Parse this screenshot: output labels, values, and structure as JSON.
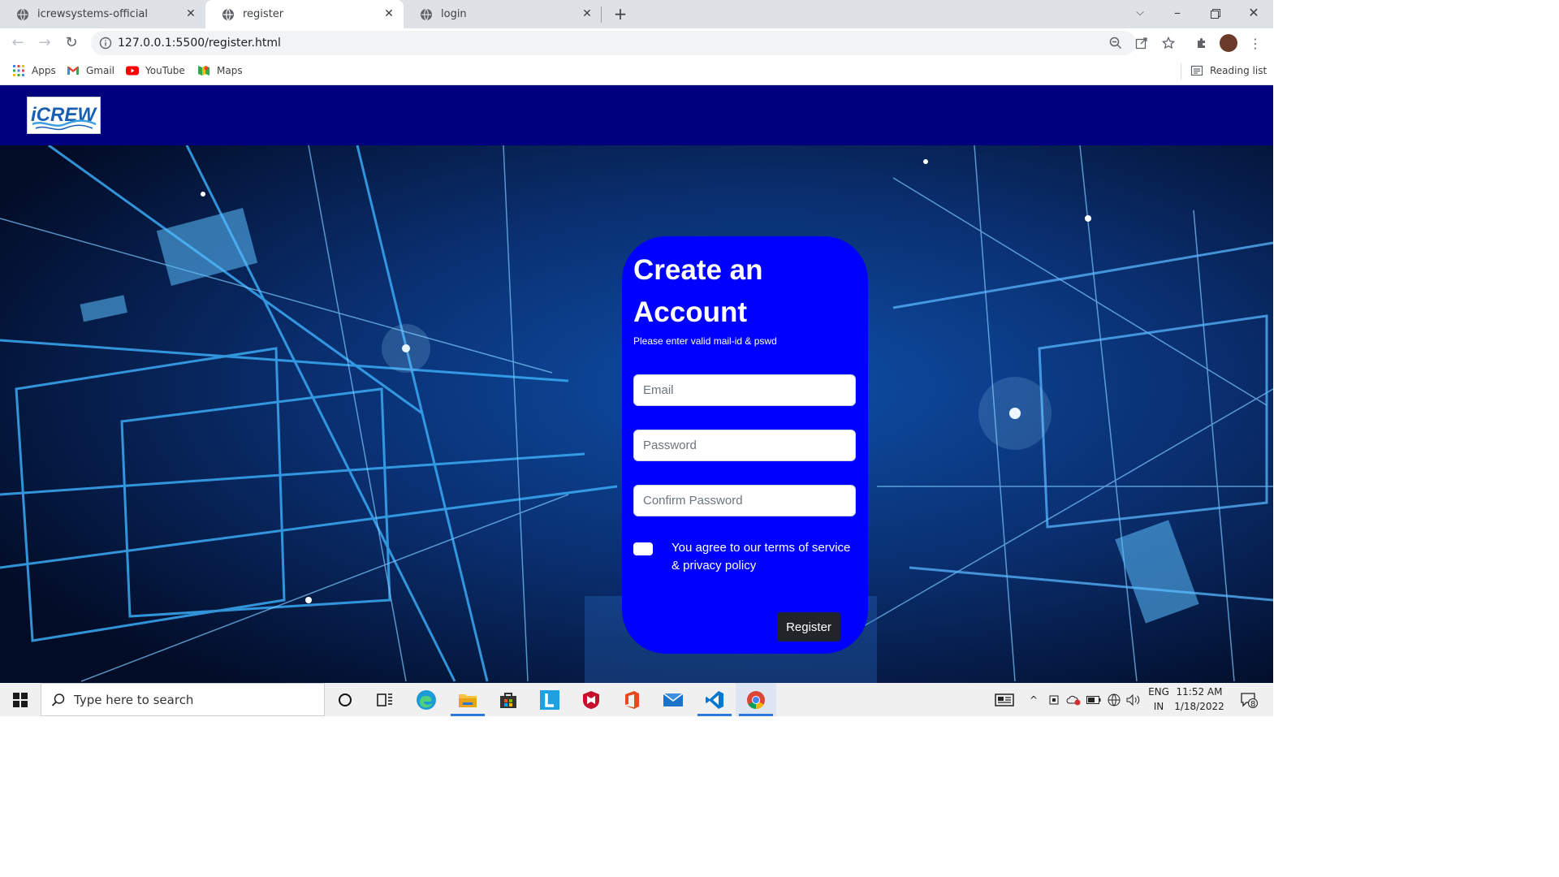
{
  "browser": {
    "tabs": [
      {
        "title": "icrewsystems-official"
      },
      {
        "title": "register"
      },
      {
        "title": "login"
      }
    ],
    "url": "127.0.0.1:5500/register.html",
    "bookmarks": [
      {
        "label": "Apps",
        "icon": "apps-grid-icon"
      },
      {
        "label": "Gmail",
        "icon": "gmail-icon"
      },
      {
        "label": "YouTube",
        "icon": "youtube-icon"
      },
      {
        "label": "Maps",
        "icon": "maps-icon"
      }
    ],
    "reading_list": "Reading list"
  },
  "page": {
    "logo_text": "iCREW",
    "form": {
      "title": "Create an Account",
      "subtitle": "Please enter valid mail-id & pswd",
      "email_placeholder": "Email",
      "password_placeholder": "Password",
      "confirm_placeholder": "Confirm Password",
      "terms": "You agree to our terms of service & privacy policy",
      "register_label": "Register"
    },
    "colors": {
      "navbar": "#00007f",
      "card": "#0000fe",
      "button": "#212529"
    }
  },
  "taskbar": {
    "search_placeholder": "Type here to search",
    "lang_top": "ENG",
    "lang_bottom": "IN",
    "time": "11:52 AM",
    "date": "1/18/2022",
    "notifications": "8"
  }
}
